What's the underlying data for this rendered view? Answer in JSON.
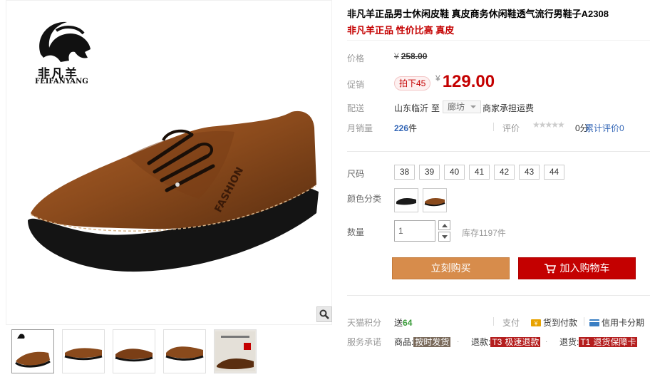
{
  "brand": {
    "name_cn": "非凡羊",
    "name_en": "FEIFANYANG"
  },
  "product": {
    "title": "非凡羊正品男士休闲皮鞋 真皮商务休闲鞋透气流行男鞋子A2308",
    "subtitle": "非凡羊正品 性价比高 真皮"
  },
  "price": {
    "label": "价格",
    "currency": "¥",
    "original": "258.00",
    "promo_label": "促销",
    "promo_tag": "拍下45",
    "promo_price": "129.00"
  },
  "shipping": {
    "label": "配送",
    "from": "山东临沂",
    "to_label": "至",
    "destination": "廊坊",
    "note": "商家承担运费"
  },
  "sales": {
    "label": "月销量",
    "count": "226",
    "unit": "件",
    "rating_label": "评价",
    "stars": "★★★★★",
    "score": "0分",
    "reviews_link": "累计评价0"
  },
  "options": {
    "size_label": "尺码",
    "sizes": [
      "38",
      "39",
      "40",
      "41",
      "42",
      "43",
      "44"
    ],
    "color_label": "颜色分类",
    "qty_label": "数量",
    "qty_value": "1",
    "stock": "库存1197件"
  },
  "actions": {
    "buy_now": "立刻购买",
    "add_to_cart": "加入购物车"
  },
  "extra": {
    "points_label": "天猫积分",
    "points_prefix": "送",
    "points_value": "64",
    "pay_label": "支付",
    "pay_cod": "货到付款",
    "pay_credit": "信用卡分期",
    "service_label": "服务承诺",
    "service_items": [
      {
        "prefix": "商品:",
        "code": "",
        "tag": "按时发货"
      },
      {
        "prefix": "退款:",
        "code": "T3",
        "tag": "极速退款"
      },
      {
        "prefix": "退货:",
        "code": "T1",
        "tag": "退货保障卡"
      }
    ]
  },
  "icons": [
    "zoom-icon",
    "cart-icon",
    "cod-icon",
    "credit-card-icon",
    "goat-logo-icon"
  ],
  "colors": {
    "accent_red": "#c40000",
    "buy_orange": "#d78c4b",
    "link_blue": "#3366b6"
  }
}
